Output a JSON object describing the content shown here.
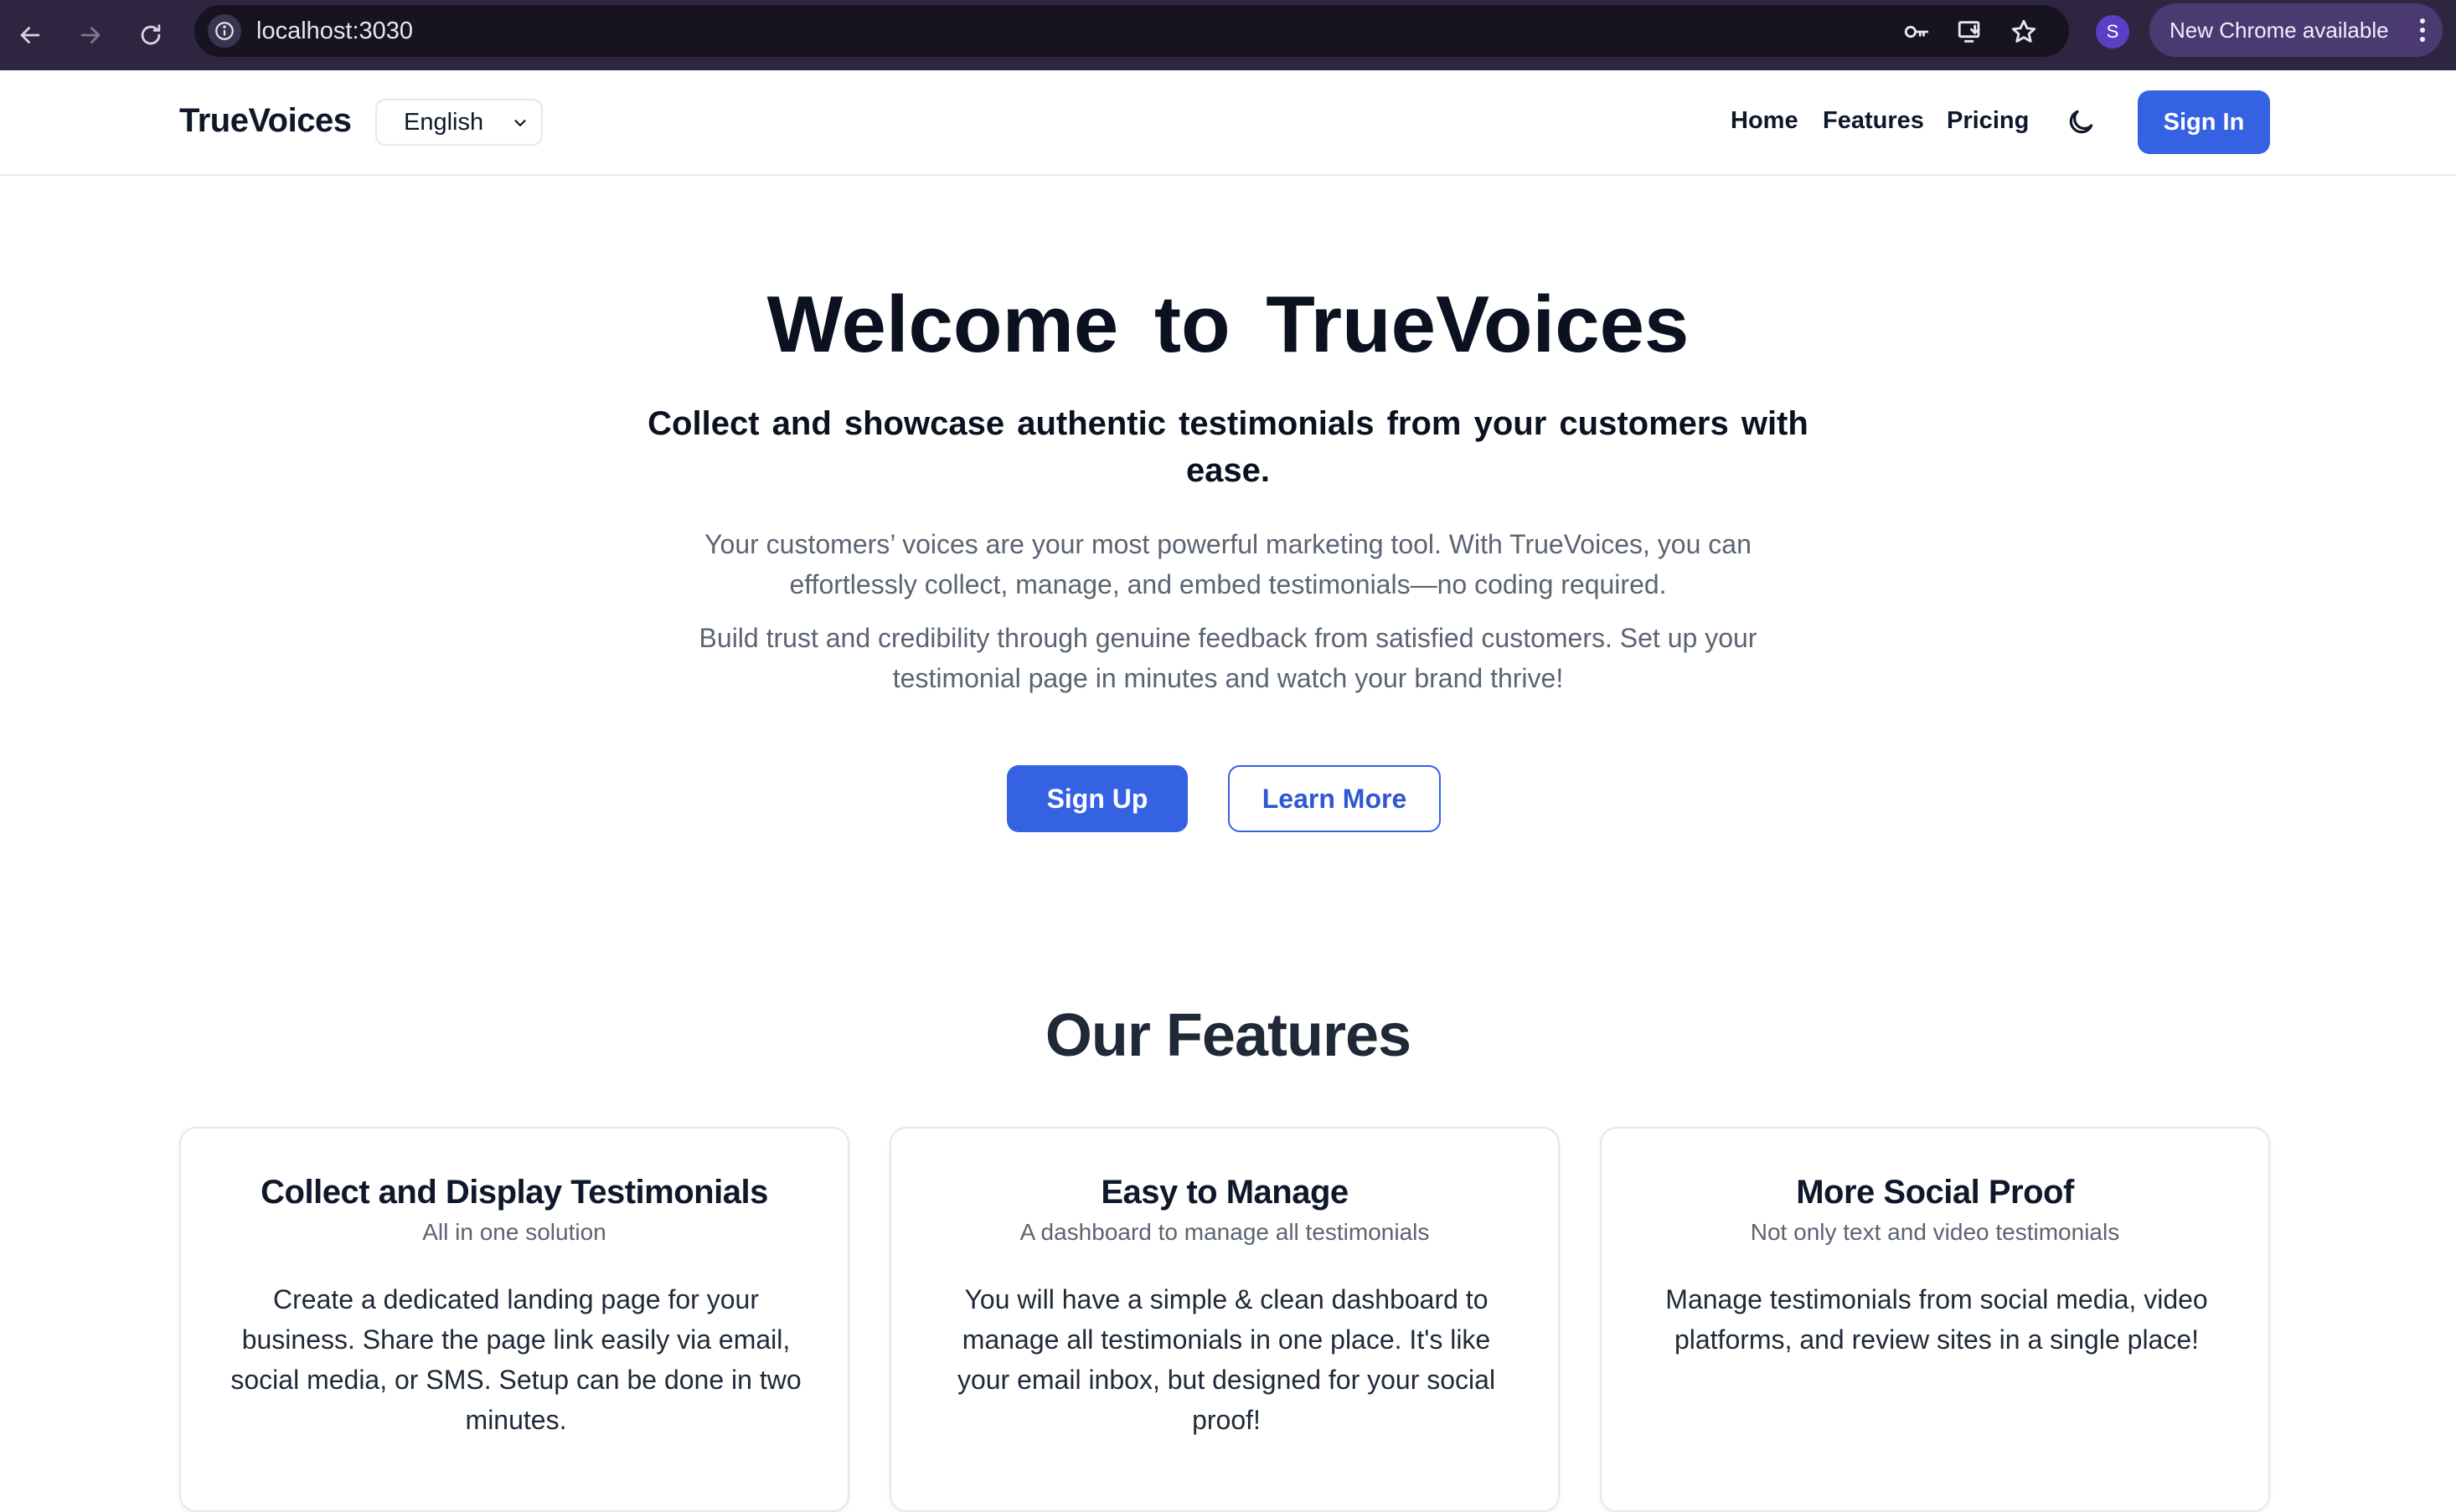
{
  "browser": {
    "url": "localhost:3030",
    "profile_initial": "S",
    "update_label": "New Chrome available",
    "icons": [
      "back-icon",
      "forward-icon",
      "reload-icon",
      "site-info-icon",
      "password-key-icon",
      "install-app-icon",
      "bookmark-star-icon",
      "more-vert-icon"
    ]
  },
  "header": {
    "brand": "TrueVoices",
    "language": "English",
    "nav": {
      "home": "Home",
      "features": "Features",
      "pricing": "Pricing"
    },
    "theme_icon": "moon-icon",
    "signin_label": "Sign In"
  },
  "hero": {
    "title": "Welcome to TrueVoices",
    "subtitle": "Collect and showcase authentic testimonials from your customers with ease.",
    "para1": "Your customers’ voices are your most powerful marketing tool. With TrueVoices, you can effortlessly collect, manage, and embed testimonials—no coding required.",
    "para2": "Build trust and credibility through genuine feedback from satisfied customers. Set up your testimonial page in minutes and watch your brand thrive!",
    "signup_label": "Sign Up",
    "learn_more_label": "Learn More"
  },
  "features": {
    "title": "Our Features",
    "cards": [
      {
        "title": "Collect and Display Testimonials",
        "subtitle": "All in one solution",
        "body": "Create a dedicated landing page for your business. Share the page link easily via email, social media, or SMS. Setup can be done in two minutes."
      },
      {
        "title": "Easy to Manage",
        "subtitle": "A dashboard to manage all testimonials",
        "body": "You will have a simple & clean dashboard to manage all testimonials in one place. It's like your email inbox, but designed for your social proof!"
      },
      {
        "title": "More Social Proof",
        "subtitle": "Not only text and video testimonials",
        "body": "Manage testimonials from social media, video platforms, and review sites in a single place!"
      }
    ]
  },
  "colors": {
    "accent": "#3561e3",
    "chrome_bg": "#2e2640",
    "text_dark": "#0f172a",
    "text_muted": "#5b6472"
  }
}
